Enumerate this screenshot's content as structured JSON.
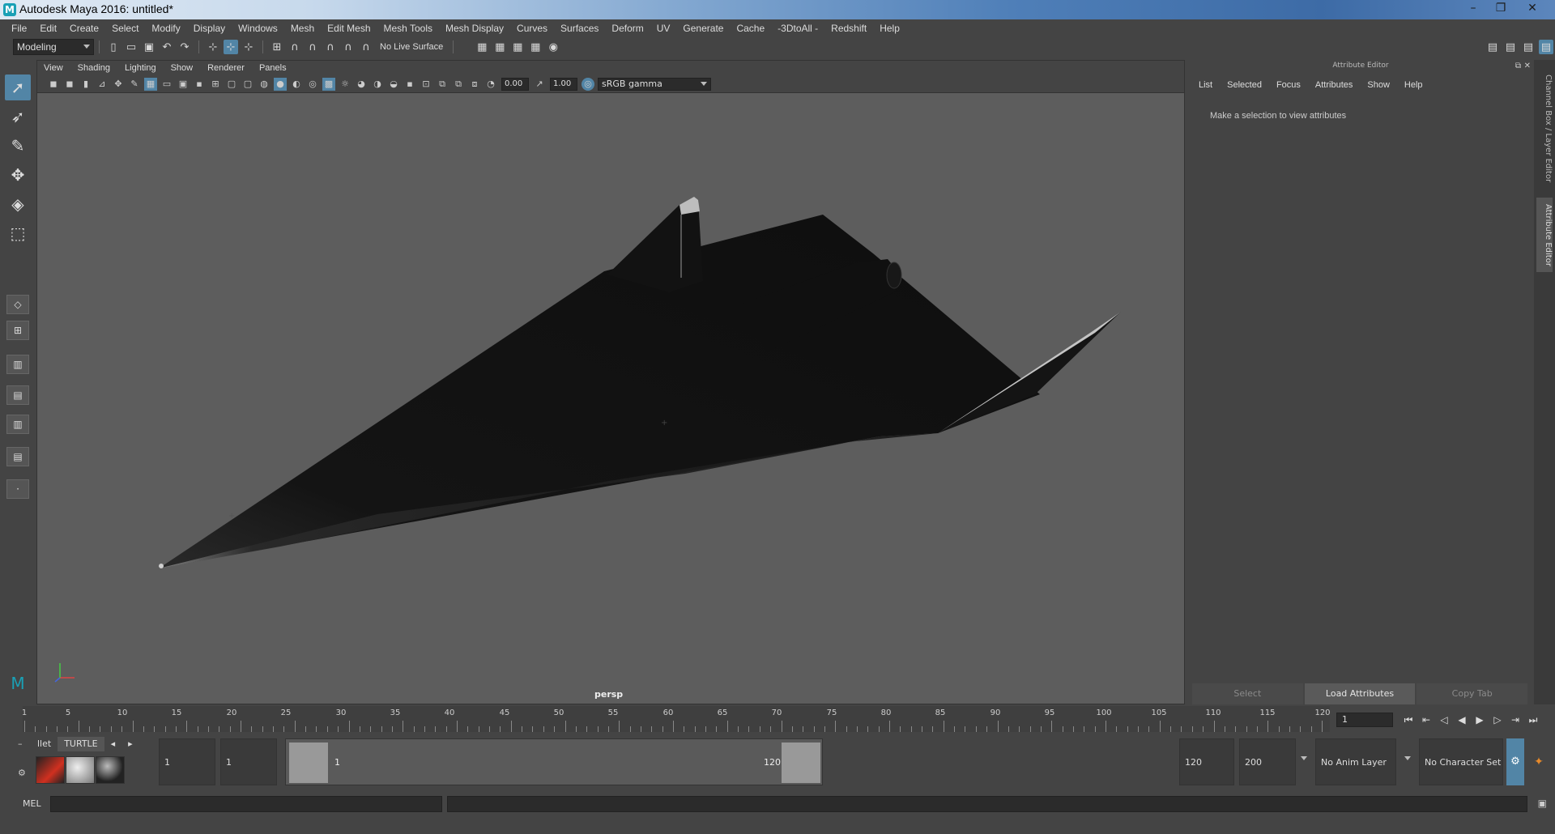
{
  "window": {
    "title": "Autodesk Maya 2016: untitled*",
    "app_icon": "maya-icon",
    "controls": [
      "–",
      "❐",
      "✕"
    ]
  },
  "menubar": {
    "items": [
      "File",
      "Edit",
      "Create",
      "Select",
      "Modify",
      "Display",
      "Windows",
      "Mesh",
      "Edit Mesh",
      "Mesh Tools",
      "Mesh Display",
      "Curves",
      "Surfaces",
      "Deform",
      "UV",
      "Generate",
      "Cache",
      "-3DtoAll -",
      "Redshift",
      "Help"
    ]
  },
  "statusline": {
    "mode": "Modeling",
    "live_surface": "No Live Surface"
  },
  "viewport": {
    "menu": [
      "View",
      "Shading",
      "Lighting",
      "Show",
      "Renderer",
      "Panels"
    ],
    "exposure": "0.00",
    "gamma": "1.00",
    "color_space": "sRGB gamma",
    "camera_label": "persp"
  },
  "attribute_editor": {
    "title": "Attribute Editor",
    "menu": [
      "List",
      "Selected",
      "Focus",
      "Attributes",
      "Show",
      "Help"
    ],
    "message": "Make a selection to view attributes",
    "buttons": {
      "select": "Select",
      "load_attributes": "Load Attributes",
      "copy_tab": "Copy Tab"
    }
  },
  "side_tabs": {
    "channel_box": "Channel Box / Layer Editor",
    "attribute_editor": "Attribute Editor"
  },
  "timeline": {
    "ticks": [
      "1",
      "5",
      "10",
      "15",
      "20",
      "25",
      "30",
      "35",
      "40",
      "45",
      "50",
      "55",
      "60",
      "65",
      "70",
      "75",
      "80",
      "85",
      "90",
      "95",
      "100",
      "105",
      "110",
      "115",
      "120"
    ],
    "current_frame": "1"
  },
  "range": {
    "shelf_tabs": [
      "llet",
      "TURTLE"
    ],
    "start_time": "1",
    "playback_start": "1",
    "range_start_label": "1",
    "range_end_label": "120",
    "playback_end": "120",
    "end_time": "200",
    "anim_layer": "No Anim Layer",
    "character_set": "No Character Set"
  },
  "command_line": {
    "label": "MEL"
  },
  "colors": {
    "accent": "#5285a6",
    "viewport_bg": "#5d5d5d",
    "panel_bg": "#444444"
  }
}
